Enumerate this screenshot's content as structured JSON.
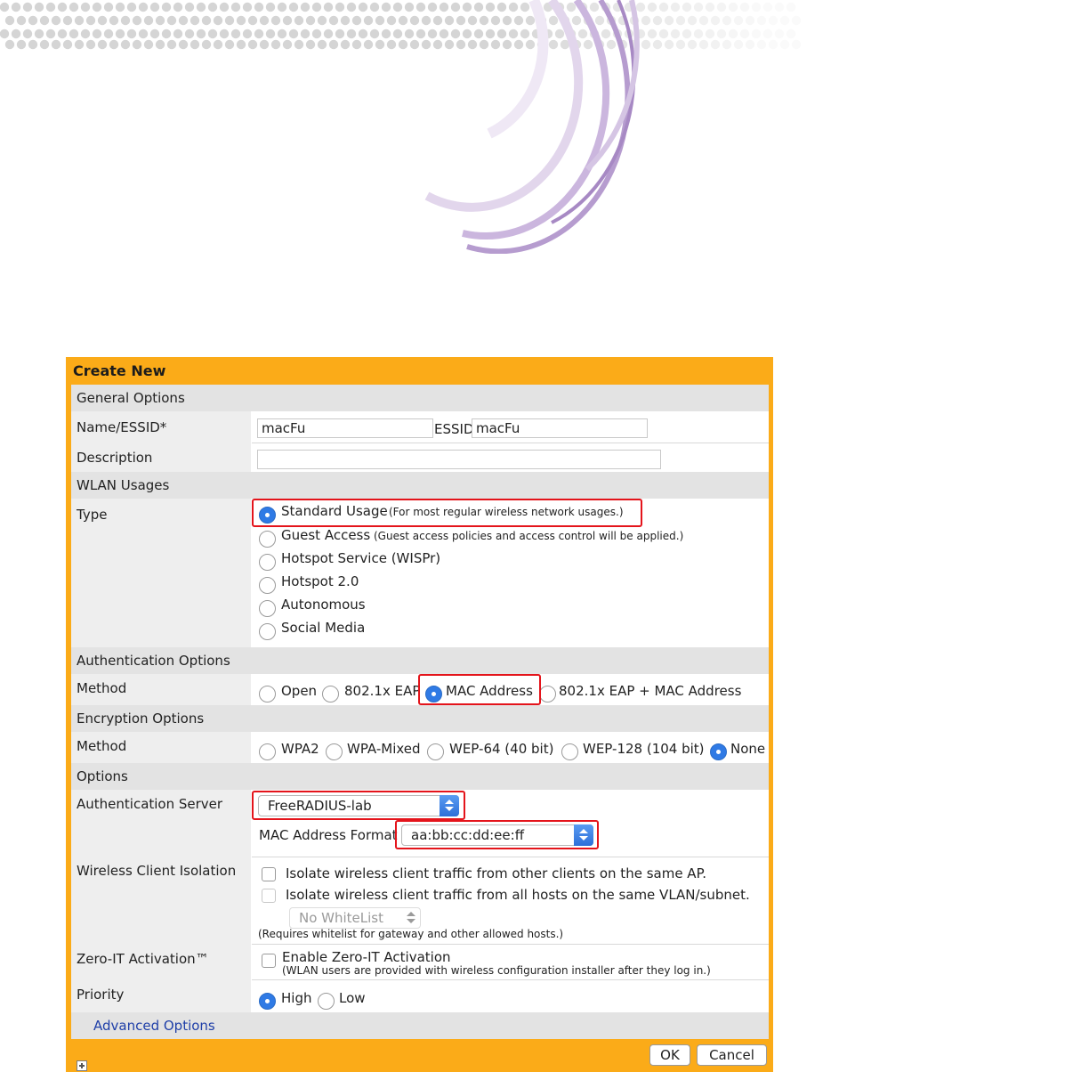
{
  "dialog": {
    "title": "Create New",
    "ok_label": "OK",
    "cancel_label": "Cancel"
  },
  "sections": {
    "general": "General Options",
    "wlan_usages": "WLAN Usages",
    "authentication": "Authentication Options",
    "encryption": "Encryption Options",
    "options": "Options"
  },
  "general": {
    "name_label": "Name/ESSID*",
    "name_value": "macFu",
    "essid_label": "ESSID",
    "essid_value": "macFu",
    "description_label": "Description",
    "description_value": ""
  },
  "type": {
    "label": "Type",
    "options": [
      {
        "label": "Standard Usage",
        "note": "(For most regular wireless network usages.)",
        "selected": true
      },
      {
        "label": "Guest Access",
        "note": "(Guest access policies and access control will be applied.)",
        "selected": false
      },
      {
        "label": "Hotspot Service (WISPr)",
        "note": "",
        "selected": false
      },
      {
        "label": "Hotspot 2.0",
        "note": "",
        "selected": false
      },
      {
        "label": "Autonomous",
        "note": "",
        "selected": false
      },
      {
        "label": "Social Media",
        "note": "",
        "selected": false
      }
    ]
  },
  "auth_method": {
    "label": "Method",
    "options": [
      "Open",
      "802.1x EAP",
      "MAC Address",
      "802.1x EAP + MAC Address"
    ],
    "selected": "MAC Address"
  },
  "enc_method": {
    "label": "Method",
    "options": [
      "WPA2",
      "WPA-Mixed",
      "WEP-64 (40 bit)",
      "WEP-128 (104 bit)",
      "None"
    ],
    "selected": "None"
  },
  "auth_server": {
    "label": "Authentication Server",
    "value": "FreeRADIUS-lab",
    "mac_format_label": "MAC Address Format",
    "mac_format_value": "aa:bb:cc:dd:ee:ff"
  },
  "isolation": {
    "label": "Wireless Client Isolation",
    "opt1": "Isolate wireless client traffic from other clients on the same AP.",
    "opt2": "Isolate wireless client traffic from all hosts on the same VLAN/subnet.",
    "whitelist_value": "No WhiteList",
    "note": "(Requires whitelist for gateway and other allowed hosts.)"
  },
  "zero_it": {
    "label": "Zero-IT Activation™",
    "option": "Enable Zero-IT Activation",
    "note": "(WLAN users are provided with wireless configuration installer after they log in.)"
  },
  "priority": {
    "label": "Priority",
    "options": [
      "High",
      "Low"
    ],
    "selected": "High"
  },
  "advanced": {
    "label": "Advanced Options"
  },
  "colors": {
    "dialog_frame": "#fbab18",
    "section_header": "#e3e3e3",
    "label_column": "#eeeeee",
    "highlight_box": "#e4141b",
    "radio_selected": "#2f7ae5",
    "decor_dots": "#d5d5d5",
    "decor_arcs": "#c9b3dc"
  }
}
